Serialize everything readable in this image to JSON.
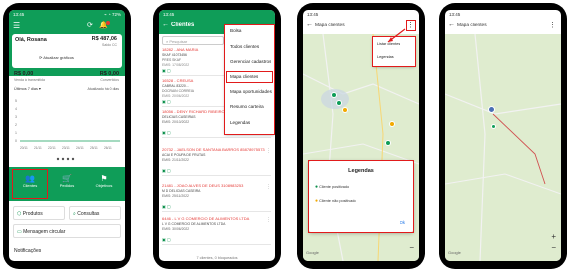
{
  "p1": {
    "status_time": "13:45",
    "status_right": "⌁ ◔ 72%",
    "user_name": "Olá, Rosana",
    "amount": "R$ 487,06",
    "balance_label": "Saldo CC",
    "update_link": "⟳ Atualizar gráficos",
    "sales_amount": "R$ 0,00",
    "sales_label": "Venda à transmitida",
    "conv_amount": "R$ 0,00",
    "conv_label": "Convertidos",
    "period": "Últimos 7 dias",
    "chart_label": "Atualizado há 0 dias",
    "y_ticks": [
      "5",
      "4",
      "3",
      "2",
      "1",
      "0"
    ],
    "x_ticks": [
      "20/11",
      "21/11",
      "22/11",
      "23/11",
      "24/11",
      "25/11",
      "26/11"
    ],
    "tiles": [
      {
        "label": "Clientes"
      },
      {
        "label": "Pedidos"
      },
      {
        "label": "Objetivos"
      }
    ],
    "produtos": "Produtos",
    "consultas": "Consultas",
    "mensagem": "Mensagem circular",
    "notificacoes": "Notificações"
  },
  "p2": {
    "status_time": "13:45",
    "title": "Clientes",
    "search_placeholder": "Pesquisar",
    "menu": [
      "Bolsa",
      "Todos clientes",
      "Gerenciar cadastros",
      "Mapa clientes",
      "Mapa oportunidades",
      "Resumo carteira",
      "Legendas"
    ],
    "clients": [
      {
        "name": "18282 - ANA MARIA",
        "l1": "SKAF 41073456",
        "l2": "PRES SKAF",
        "l3": "EMIS: 17/08/2022"
      },
      {
        "name": "16528 - CREUSA",
        "l1": "CABRAL 83220...",
        "l2": "DOCRAIN CORREIA",
        "l3": "EMIS: 20/06/2022"
      },
      {
        "name": "18056 - DENY RICHARD RIBEIRO BORGES DE DEUS",
        "l1": "DELICIAS CASEIRAS",
        "l2": "EMIS: 20/10/2022",
        "l3": ""
      },
      {
        "name": "20732 - JAELSON DE SANTANA BARROS 85878975573",
        "l1": "ACAI E POUPA DE FRUTAS",
        "l2": "EMIS: 21/11/2022",
        "l3": ""
      },
      {
        "name": "21481 - JOAO ALVES DE DEUS 3108983253",
        "l1": "M D DELICIAS CASEIRA",
        "l2": "EMIS: 25/11/2022",
        "l3": ""
      },
      {
        "name": "6446 - L V G COMERCIO DE ALIMENTOS LTDA",
        "l1": "L V G COMERCIO DE ALIMENTOS LTDA",
        "l2": "EMIS: 30/06/2022",
        "l3": ""
      }
    ],
    "footer": "7 clientes, 0 bloqueados"
  },
  "p3": {
    "status_time": "13:45",
    "title": "Mapa clientes",
    "menu": [
      "Listar clientes",
      "Legendas"
    ],
    "legend_title": "Legendas",
    "legend_items": [
      "Cliente positivado",
      "Cliente não positivado"
    ],
    "ok": "Ok",
    "google": "Google"
  },
  "p4": {
    "status_time": "13:45",
    "title": "Mapa clientes",
    "google": "Google"
  },
  "colors": {
    "green": "#0f9d58",
    "red": "#e11b1b",
    "map_bg": "#dfeccf"
  }
}
